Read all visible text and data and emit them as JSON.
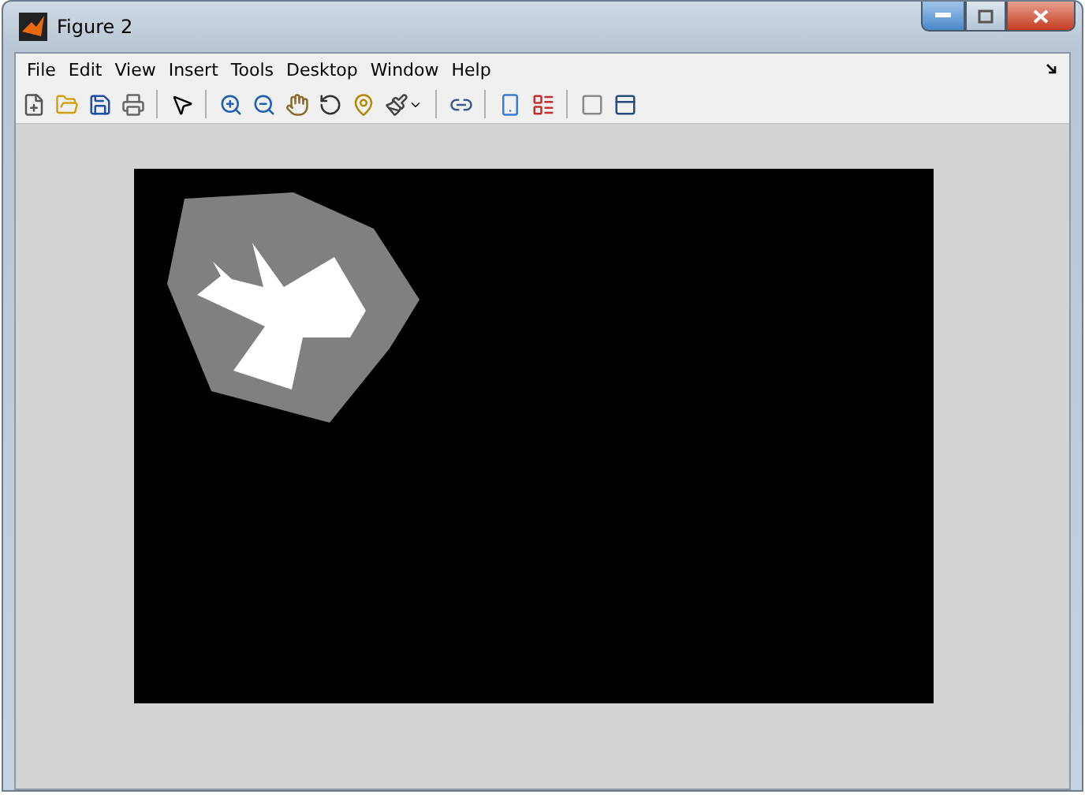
{
  "window": {
    "title": "Figure 2"
  },
  "menu": [
    "File",
    "Edit",
    "View",
    "Insert",
    "Tools",
    "Desktop",
    "Window",
    "Help"
  ]
}
